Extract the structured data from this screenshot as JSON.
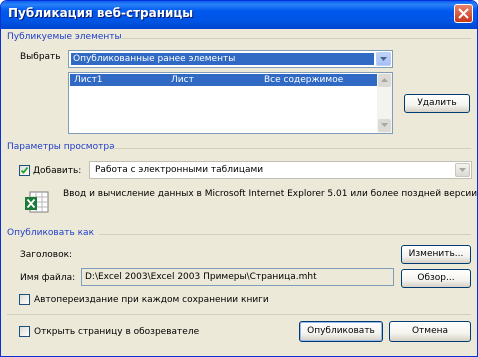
{
  "window": {
    "title": "Публикация веб-страницы"
  },
  "published_items": {
    "group_label": "Публикуемые элементы",
    "select_label": "Выбрать",
    "select_value": "Опубликованные ранее элементы",
    "list_rows": [
      {
        "name": "Лист1",
        "type": "Лист",
        "content": "Все содержимое"
      }
    ],
    "delete_button": "Удалить"
  },
  "view_options": {
    "group_label": "Параметры просмотра",
    "add_label": "Добавить:",
    "add_checked": true,
    "add_value": "Работа с электронными таблицами",
    "description": "Ввод и вычисление данных в Microsoft Internet Explorer 5.01 или более поздней версии."
  },
  "publish_as": {
    "group_label": "Опубликовать как",
    "title_label": "Заголовок:",
    "change_button": "Изменить...",
    "filename_label": "Имя файла:",
    "filename_value": "D:\\Excel 2003\\Excel 2003 Примеры\\Страница.mht",
    "browse_button": "Обзор...",
    "autorepublish_label": "Автопереиздание при каждом сохранении книги",
    "autorepublish_checked": false
  },
  "footer": {
    "open_in_browser_label": "Открыть страницу в обозревателе",
    "open_in_browser_checked": false,
    "publish_button": "Опубликовать",
    "cancel_button": "Отмена"
  },
  "colors": {
    "titlebar": "#0058ee",
    "group_label": "#1f3dc9",
    "selection": "#316ac5",
    "dialog_bg": "#ece9d8",
    "excel_green": "#1d7a3a"
  },
  "icons": [
    "close-icon",
    "dropdown-arrow-icon",
    "checkmark-icon",
    "excel-spreadsheet-icon",
    "scroll-up-icon",
    "scroll-down-icon"
  ]
}
